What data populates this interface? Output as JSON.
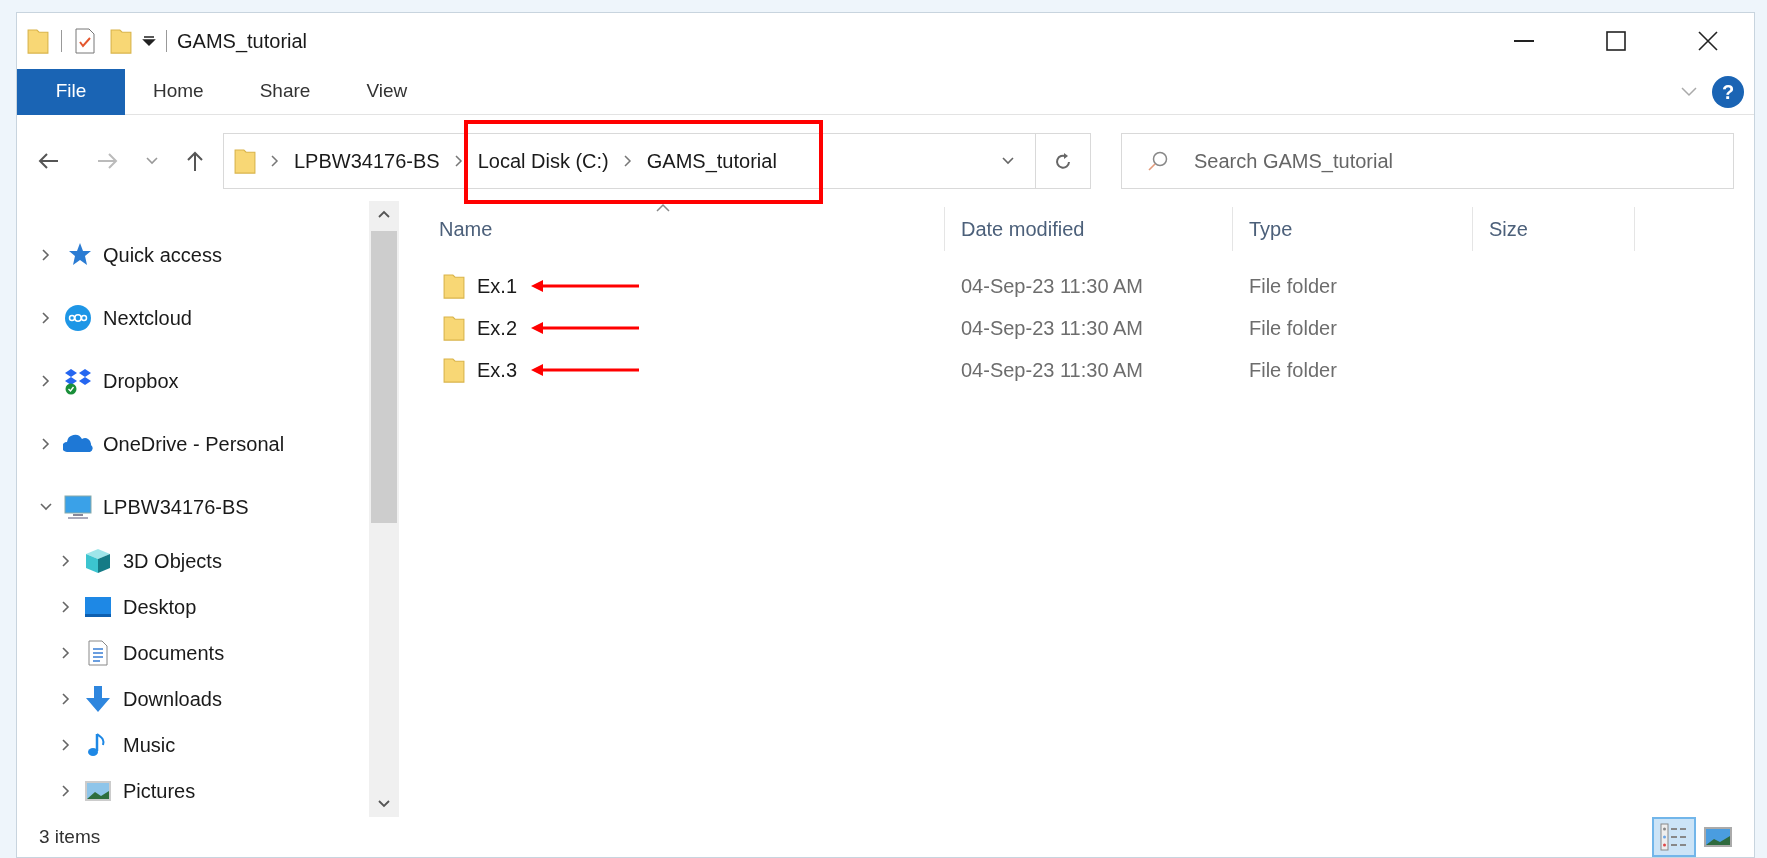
{
  "window": {
    "title": "GAMS_tutorial"
  },
  "ribbon_tabs": [
    {
      "label": "File",
      "selected": true
    },
    {
      "label": "Home",
      "selected": false
    },
    {
      "label": "Share",
      "selected": false
    },
    {
      "label": "View",
      "selected": false
    }
  ],
  "help_button": "?",
  "address_bar": {
    "segments": [
      "LPBW34176-BS"
    ],
    "boxed_segments": [
      "Local Disk (C:)",
      "GAMS_tutorial"
    ]
  },
  "search": {
    "placeholder": "Search GAMS_tutorial"
  },
  "nav": [
    {
      "label": "Quick access",
      "kind": "star",
      "expanded": false
    },
    {
      "label": "Nextcloud",
      "kind": "nextcloud",
      "expanded": false
    },
    {
      "label": "Dropbox",
      "kind": "dropbox",
      "expanded": false
    },
    {
      "label": "OneDrive - Personal",
      "kind": "onedrive",
      "expanded": false
    },
    {
      "label": "LPBW34176-BS",
      "kind": "pc",
      "expanded": true,
      "children": [
        {
          "label": "3D Objects",
          "kind": "cube",
          "expanded": false
        },
        {
          "label": "Desktop",
          "kind": "desktop",
          "expanded": false
        },
        {
          "label": "Documents",
          "kind": "documents",
          "expanded": false
        },
        {
          "label": "Downloads",
          "kind": "downloads",
          "expanded": false
        },
        {
          "label": "Music",
          "kind": "music",
          "expanded": false
        },
        {
          "label": "Pictures",
          "kind": "pictures",
          "expanded": false
        }
      ]
    }
  ],
  "columns": [
    "Name",
    "Date modified",
    "Type",
    "Size"
  ],
  "rows": [
    {
      "name": "Ex.1",
      "date": "04-Sep-23 11:30 AM",
      "type": "File folder",
      "arrow": true
    },
    {
      "name": "Ex.2",
      "date": "04-Sep-23 11:30 AM",
      "type": "File folder",
      "arrow": true
    },
    {
      "name": "Ex.3",
      "date": "04-Sep-23 11:30 AM",
      "type": "File folder",
      "arrow": true
    }
  ],
  "status_bar": {
    "text": "3 items"
  },
  "views": [
    {
      "kind": "details",
      "selected": true
    },
    {
      "kind": "tiles",
      "selected": false
    }
  ]
}
